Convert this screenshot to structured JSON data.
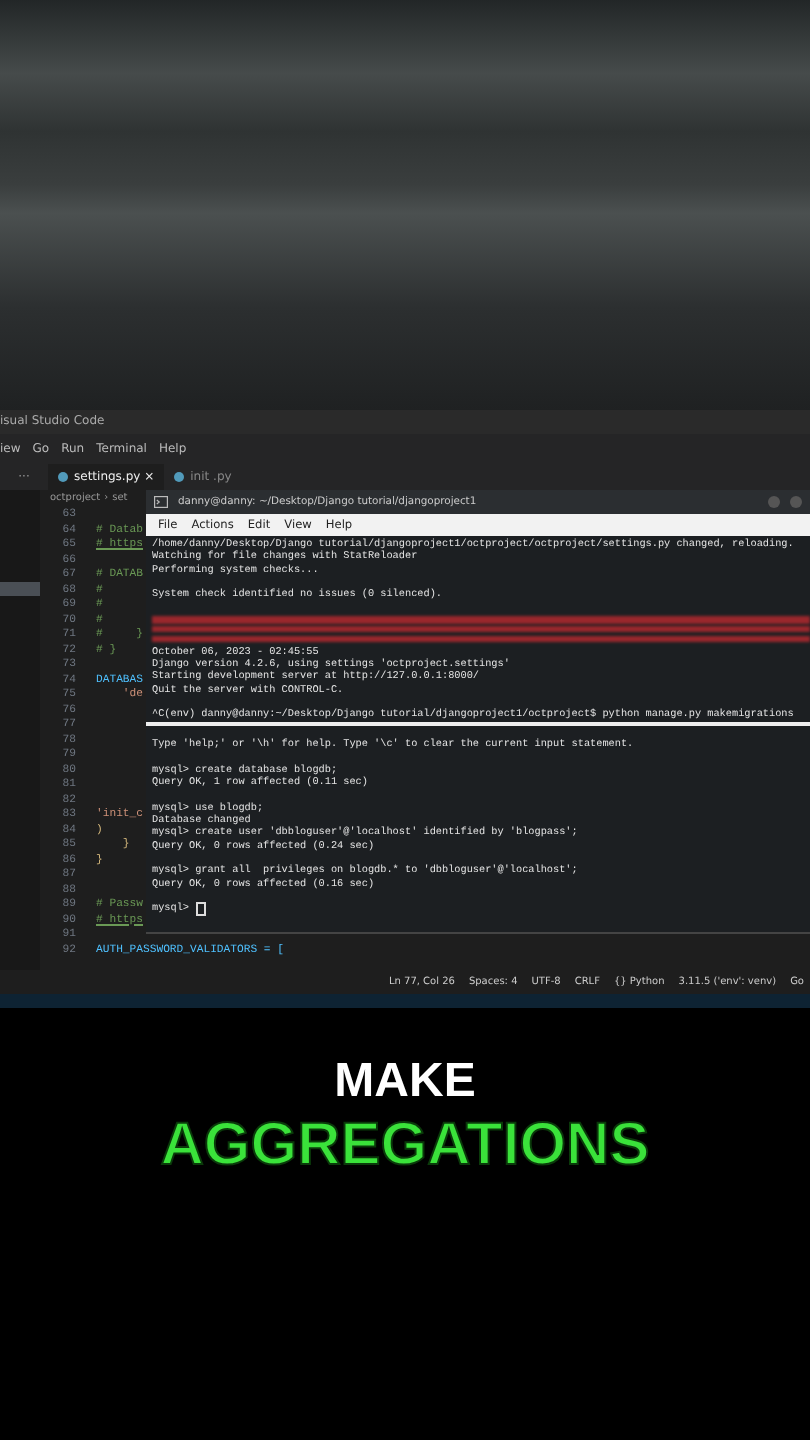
{
  "editor": {
    "title": "isual Studio Code",
    "menu": [
      "iew",
      "Go",
      "Run",
      "Terminal",
      "Help"
    ],
    "more": "···",
    "tabs": [
      {
        "label": "settings.py",
        "close": "×",
        "selected": true
      },
      {
        "label": "init .py",
        "selected": false
      }
    ],
    "breadcrumb": [
      "octproject",
      "›",
      "set"
    ],
    "lines": [
      {
        "number": "63"
      },
      {
        "number": "64",
        "kind": "comment",
        "code": "# Datab"
      },
      {
        "number": "65",
        "kind": "link",
        "code": "# https"
      },
      {
        "number": "66"
      },
      {
        "number": "67",
        "kind": "comment",
        "code": "# DATAB"
      },
      {
        "number": "68",
        "kind": "comment",
        "code": "#"
      },
      {
        "number": "69",
        "kind": "comment",
        "code": "#"
      },
      {
        "number": "70",
        "kind": "comment",
        "code": "#"
      },
      {
        "number": "71",
        "kind": "comment",
        "code": "#     }"
      },
      {
        "number": "72",
        "kind": "comment",
        "code": "# }"
      },
      {
        "number": "73"
      },
      {
        "number": "74",
        "kind": "variable",
        "code": "DATABAS"
      },
      {
        "number": "75",
        "kind": "string",
        "code": "    'de"
      },
      {
        "number": "76"
      },
      {
        "number": "77"
      },
      {
        "number": "78"
      },
      {
        "number": "79"
      },
      {
        "number": "80"
      },
      {
        "number": "81"
      },
      {
        "number": "82"
      },
      {
        "number": "83",
        "kind": "string",
        "code": "'init_c"
      },
      {
        "number": "84",
        "kind": "bracket",
        "code": ")"
      },
      {
        "number": "85",
        "kind": "bracket",
        "code": "    }"
      },
      {
        "number": "86",
        "kind": "bracket",
        "code": "}"
      },
      {
        "number": "87"
      },
      {
        "number": "88"
      },
      {
        "number": "89",
        "kind": "comment",
        "code": "# Passw"
      },
      {
        "number": "90",
        "kind": "link",
        "code": "# https"
      },
      {
        "number": "91"
      },
      {
        "number": "92",
        "kind": "variable",
        "code": "AUTH_PASSWORD_VALIDATORS = ["
      }
    ],
    "status_bar": [
      "Ln 77, Col 26",
      "Spaces: 4",
      "UTF-8",
      "CRLF",
      "{} Python",
      "3.11.5 ('env': venv)",
      "Go"
    ]
  },
  "terminal": {
    "title": "danny@danny: ~/Desktop/Django tutorial/djangoproject1",
    "menu": [
      "File",
      "Actions",
      "Edit",
      "View",
      "Help"
    ],
    "server_output": [
      {
        "kind": "text",
        "text": "/home/danny/Desktop/Django tutorial/djangoproject1/octproject/octproject/settings.py changed, reloading."
      },
      {
        "kind": "text",
        "text": "Watching for file changes with StatReloader"
      },
      {
        "kind": "text",
        "text": "Performing system checks..."
      },
      {
        "kind": "blank"
      },
      {
        "kind": "text",
        "text": "System check identified no issues (0 silenced)."
      },
      {
        "kind": "blank"
      },
      {
        "kind": "error"
      },
      {
        "kind": "error"
      },
      {
        "kind": "error"
      },
      {
        "kind": "text",
        "text": "October 06, 2023 - 02:45:55"
      },
      {
        "kind": "text",
        "text": "Django version 4.2.6, using settings 'octproject.settings'"
      },
      {
        "kind": "text",
        "text": "Starting development server at http://127.0.0.1:8000/"
      },
      {
        "kind": "text",
        "text": "Quit the server with CONTROL-C."
      },
      {
        "kind": "blank"
      },
      {
        "kind": "text",
        "text": "^C(env) danny@danny:~/Desktop/Django tutorial/djangoproject1/octproject$ python manage.py makemigrations"
      }
    ],
    "mysql_output": [
      {
        "kind": "blank"
      },
      {
        "kind": "text",
        "text": "Type 'help;' or '\\h' for help. Type '\\c' to clear the current input statement."
      },
      {
        "kind": "blank"
      },
      {
        "kind": "text",
        "text": "mysql> create database blogdb;"
      },
      {
        "kind": "text",
        "text": "Query OK, 1 row affected (0.11 sec)"
      },
      {
        "kind": "blank"
      },
      {
        "kind": "text",
        "text": "mysql> use blogdb;"
      },
      {
        "kind": "text",
        "text": "Database changed"
      },
      {
        "kind": "text",
        "text": "mysql> create user 'dbbloguser'@'localhost' identified by 'blogpass';"
      },
      {
        "kind": "text",
        "text": "Query OK, 0 rows affected (0.24 sec)"
      },
      {
        "kind": "blank"
      },
      {
        "kind": "text",
        "text": "mysql> grant all  privileges on blogdb.* to 'dbbloguser'@'localhost';"
      },
      {
        "kind": "text",
        "text": "Query OK, 0 rows affected (0.16 sec)"
      },
      {
        "kind": "blank"
      },
      {
        "kind": "prompt",
        "text": "mysql>"
      }
    ]
  },
  "caption": {
    "line_1": "MAKE",
    "line_2": "AGGREGATIONS"
  }
}
